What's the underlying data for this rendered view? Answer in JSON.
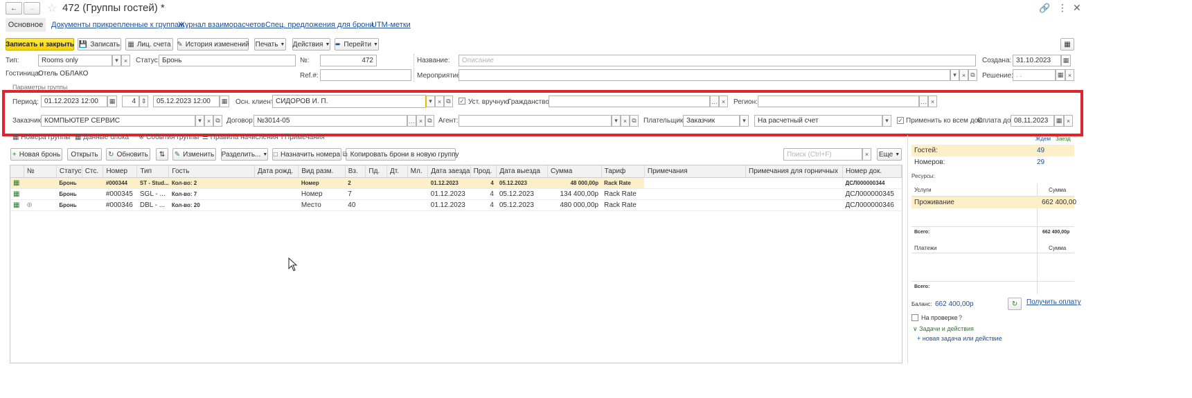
{
  "window": {
    "title": "472 (Группы гостей) *"
  },
  "nav_tabs": [
    "Основное",
    "Документы прикрепленные к группам",
    "Журнал взаиморасчетов",
    "Спец. предложения для брони",
    "UTM-метки"
  ],
  "toolbar": {
    "save_close": "Записать и закрыть",
    "save": "Записать",
    "accounts": "Лиц. счета",
    "history": "История изменений",
    "print": "Печать",
    "actions": "Действия",
    "goto": "Перейти"
  },
  "header": {
    "type_label": "Тип:",
    "type_value": "Rooms only",
    "status_label": "Статус:",
    "status_value": "Бронь",
    "no_label": "№:",
    "no_value": "472",
    "name_label": "Название:",
    "name_placeholder": "Описание",
    "created_label": "Создана:",
    "created_value": "31.10.2023",
    "hotel_label": "Гостиница:",
    "hotel_value": "Отель ОБЛАКО",
    "ref_label": "Ref.#:",
    "event_label": "Мероприятие:",
    "decision_label": "Решение:",
    "decision_value": ". .",
    "params_label": "Параметры группы"
  },
  "params": {
    "period_label": "Период:",
    "period_from": "01.12.2023 12:00",
    "nights": "4",
    "period_to": "05.12.2023 12:00",
    "client_label": "Осн. клиент:",
    "client_value": "СИДОРОВ И. П.",
    "manual_label": "Уст. вручную",
    "citizenship_label": "Гражданство:",
    "region_label": "Регион:",
    "customer_label": "Заказчик:",
    "customer_value": "КОМПЬЮТЕР СЕРВИС",
    "contract_label": "Договор:",
    "contract_value": "№3014-05",
    "agent_label": "Агент:",
    "payer_label": "Плательщик:",
    "payer_value": "Заказчик",
    "payment_method": "На расчетный счет",
    "apply_all_label": "Применить ко всем док.",
    "pay_until_label": "Оплата до:",
    "pay_until_value": "08.11.2023"
  },
  "inner_tabs": [
    "Номера группы",
    "Данные блока",
    "События группы",
    "Правила начисления",
    "Примечания"
  ],
  "table_toolbar": {
    "new_booking": "Новая бронь",
    "open": "Открыть",
    "refresh": "Обновить",
    "edit": "Изменить",
    "split": "Разделить...",
    "assign": "Назначить номера",
    "copy": "Копировать брони в новую группу",
    "search_placeholder": "Поиск (Ctrl+F)",
    "more": "Еще"
  },
  "table": {
    "columns": [
      "№",
      "Статус",
      "Стс.",
      "Номер",
      "Тип",
      "Гость",
      "Дата рожд.",
      "Вид разм.",
      "Вз.",
      "Пд.",
      "Дт.",
      "Мл.",
      "Дата заезда",
      "Прод.",
      "Дата выезда",
      "Сумма",
      "Тариф",
      "Примечания",
      "Примечания для горничных",
      "Номер док."
    ],
    "rows": [
      {
        "status": "Бронь",
        "number": "#000344",
        "type": "ST - Stud...",
        "guest": "Кол-во: 2",
        "placement": "Номер",
        "adults": "2",
        "checkin": "01.12.2023",
        "nights": "4",
        "checkout": "05.12.2023",
        "sum": "48 000,00р",
        "tariff": "Rack Rate",
        "doc": "ДСЛ000000344"
      },
      {
        "status": "Бронь",
        "number": "#000345",
        "type": "SGL - ...",
        "guest": "Кол-во: 7",
        "placement": "Номер",
        "adults": "7",
        "checkin": "01.12.2023",
        "nights": "4",
        "checkout": "05.12.2023",
        "sum": "134 400,00р",
        "tariff": "Rack Rate",
        "doc": "ДСЛ000000345"
      },
      {
        "status": "Бронь",
        "number": "#000346",
        "type": "DBL - ...",
        "guest": "Кол-во: 20",
        "placement": "Место",
        "adults": "40",
        "checkin": "01.12.2023",
        "nights": "4",
        "checkout": "05.12.2023",
        "sum": "480 000,00р",
        "tariff": "Rack Rate",
        "doc": "ДСЛ000000346"
      }
    ]
  },
  "right_panel": {
    "wait_label": "Ждем",
    "arrival_label": "Заезд",
    "guests_label": "Гостей:",
    "guests_value": "49",
    "rooms_label": "Номеров:",
    "rooms_value": "29",
    "resources_label": "Ресурсы:",
    "services_col": "Услуги",
    "sum_col": "Сумма",
    "service_name": "Проживание",
    "service_sum": "662 400,00",
    "total_label": "Всего:",
    "total_value": "662 400,00р",
    "payments_col": "Платежи",
    "payments_sum_col": "Сумма",
    "total2_label": "Всего:",
    "balance_label": "Баланс:",
    "balance_value": "662 400,00р",
    "get_payment": "Получить оплату",
    "check_label": "На проверке",
    "help": "?",
    "tasks_label": "Задачи и действия",
    "new_task": "+ новая задача или действие"
  }
}
